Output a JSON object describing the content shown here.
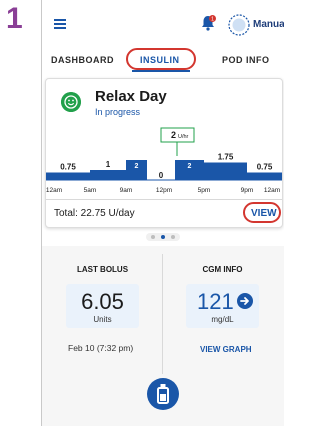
{
  "step_number": "1",
  "topbar": {
    "mode_label": "Manual",
    "notification_count": "1"
  },
  "tabs": [
    {
      "label": "DASHBOARD"
    },
    {
      "label": "INSULIN"
    },
    {
      "label": "POD INFO"
    }
  ],
  "basal_card": {
    "title": "Relax Day",
    "status": "In progress",
    "total_label": "Total: 22.75 U/day",
    "view_label": "VIEW",
    "current_rate_label": "2",
    "current_rate_unit": "U/hr"
  },
  "chart_data": {
    "type": "bar",
    "segments": [
      {
        "label": "0.75",
        "value": 0.75
      },
      {
        "label": "1",
        "value": 1
      },
      {
        "label": "2",
        "value": 2
      },
      {
        "label": "0",
        "value": 0
      },
      {
        "label": "2",
        "value": 2
      },
      {
        "label": "1.75",
        "value": 1.75
      },
      {
        "label": "0.75",
        "value": 0.75
      }
    ],
    "x_ticks": [
      "12am",
      "5am",
      "9am",
      "12pm",
      "5pm",
      "9pm",
      "12am"
    ]
  },
  "last_bolus": {
    "title": "LAST BOLUS",
    "value": "6.05",
    "unit": "Units",
    "time": "Feb 10 (7:32 pm)"
  },
  "cgm": {
    "title": "CGM INFO",
    "value": "121",
    "unit": "mg/dL",
    "link": "VIEW GRAPH"
  },
  "colors": {
    "accent": "#1a56a8",
    "highlight_ring": "#d3362f",
    "status_green": "#22a04b",
    "step_purple": "#8a3f96"
  }
}
